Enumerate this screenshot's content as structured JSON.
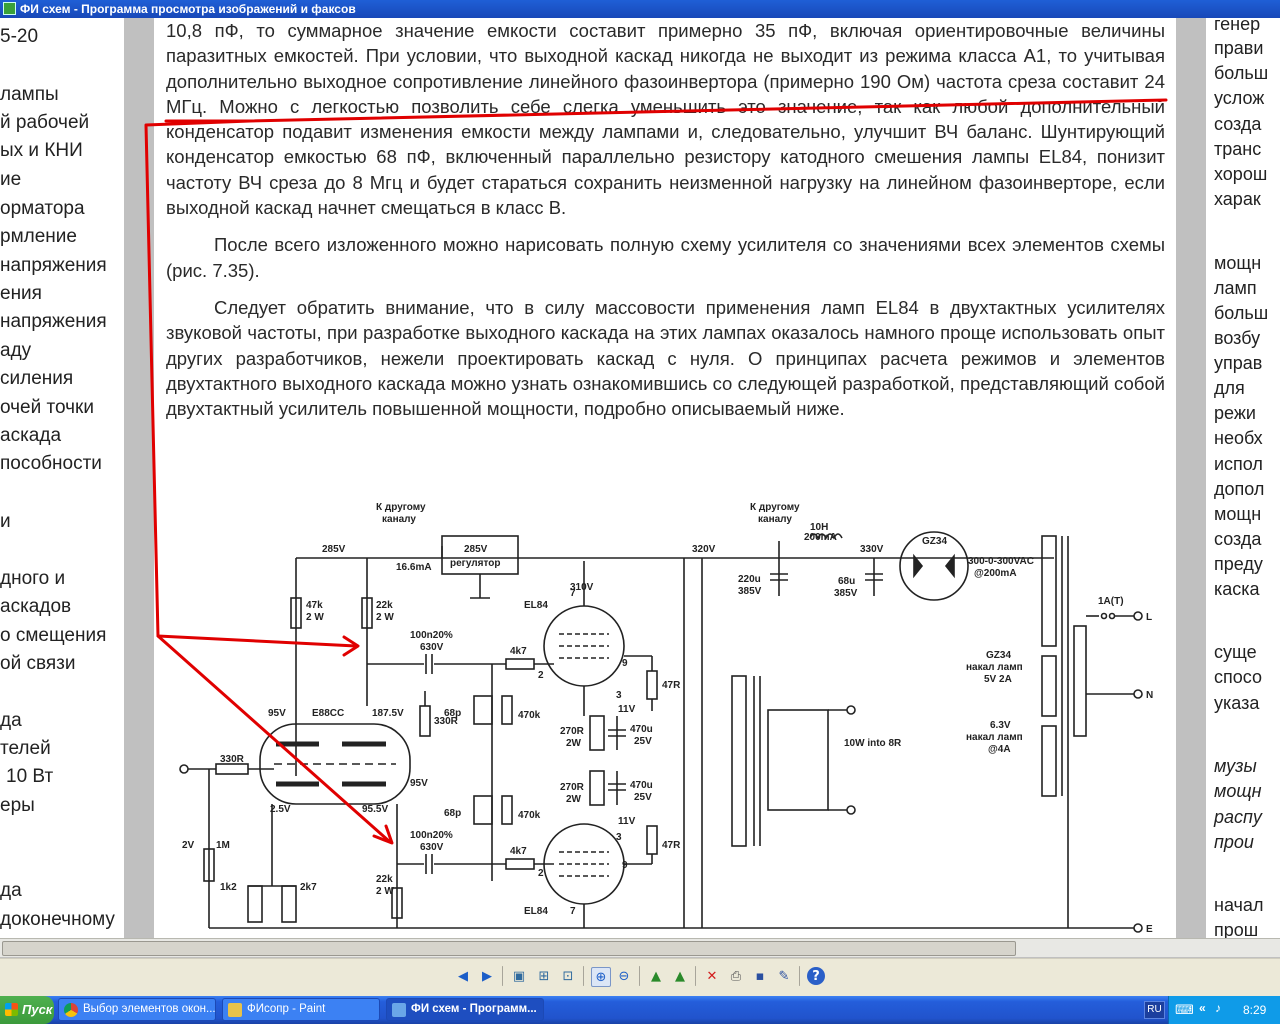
{
  "window": {
    "title": "ФИ схем - Программа просмотра изображений и факсов"
  },
  "left_page": {
    "lines": [
      "5-20",
      "лампы",
      "й рабочей",
      "ых и КНИ",
      "ие",
      "орматора",
      "рмление",
      "напряжения",
      "ения",
      "напряжения",
      "аду",
      "силения",
      "очей точки",
      "аскада",
      "пособности",
      "и",
      "дного и",
      "аскадов",
      "о смещения",
      "ой связи",
      "да",
      "телей",
      "10 Вт",
      "еры",
      "да",
      "доконечному"
    ]
  },
  "document": {
    "paragraph1": "10,8 пФ, то суммарное значение емкости составит примерно 35 пФ, включая ориентировочные величины паразитных емкостей. При условии, что выходной каскад никогда не выходит из режима класса А1, то учитывая дополнительно выходное сопротивление линейного фазоинвертора (примерно 190 Ом) частота среза составит 24 МГц. Можно с легкостью позволить себе слегка уменьшить это значение, так как любой дополнительный конденсатор подавит изменения емкости между лампами и, следовательно, улучшит ВЧ баланс. Шунтирующий конденсатор емкостью 68 пФ, включенный параллельно резистору катодного смешения лампы EL84, понизит частоту ВЧ среза до 8 Мгц и будет стараться сохранить неизменной нагрузку на линейном фазоинверторе, если выходной каскад начнет смещаться в класс В.",
    "paragraph2": "После всего изложенного можно нарисовать полную схему усилителя со значениями всех элементов схемы (рис. 7.35).",
    "paragraph3": "Следует обратить внимание, что в силу массовости применения ламп EL84 в двухтактных усилителях звуковой частоты, при разработке выходного каскада на этих лампах оказалось намного проще использовать опыт других разработчиков, нежели проектировать каскад с нуля. О принципах расчета режимов и элементов двухтактного выходного каскада можно узнать ознакомившись со следующей разработкой, представляющий собой двухтактный усилитель повышенной мощности, подробно описываемый ниже."
  },
  "schematic": {
    "labels": {
      "to_other_channel": "К другому",
      "channel": "каналу",
      "v285": "285V",
      "ma166": "16.6mA",
      "reg_v": "285V",
      "reg_name": "регулятор",
      "v320": "320V",
      "c220": "220u",
      "c220v": "385V",
      "choke": "10H",
      "choke_ma": "200mA",
      "v330": "330V",
      "c68": "68u",
      "c68v": "385V",
      "gz34_top": "GZ34",
      "trafo1": "300-0-300VAC",
      "trafo2": "@200mA",
      "fuse": "1A(T)",
      "term_l": "L",
      "term_n": "N",
      "term_e": "E",
      "gz34_heat": "GZ34",
      "heat_label": "накал ламп",
      "heat_v1": "5V 2A",
      "heat_v2": "6.3V",
      "heat_a2": "@4A",
      "r47k": "47k",
      "r47k_w": "2 W",
      "r22k": "22k",
      "r22k_w": "2 W",
      "cap100": "100n20%",
      "cap630": "630V",
      "r4k7": "4k7",
      "el84": "EL84",
      "v310": "310V",
      "pin9": "9",
      "pin3": "3",
      "pin2": "2",
      "pin7": "7",
      "r47r": "47R",
      "c68p": "68p",
      "r470k": "470k",
      "v11": "11V",
      "r270": "270R",
      "r270w": "2W",
      "c470": "470u",
      "c470v": "25V",
      "v95": "95V",
      "e88cc": "E88CC",
      "v1875": "187.5V",
      "r330r": "330R",
      "v95b": "95V",
      "r330in": "330R",
      "v25": "2.5V",
      "v955": "95.5V",
      "v2": "2V",
      "r1m": "1M",
      "r1k2": "1k2",
      "r2k7": "2k7",
      "out": "10W into 8R"
    }
  },
  "right_page": {
    "lines": [
      "генер",
      "прави",
      "больш",
      "услож",
      "созда",
      "транс",
      "хорош",
      "харак",
      "мощн",
      "ламп",
      "больш",
      "возбу",
      "управ",
      "для",
      "режи",
      "необх",
      "испол",
      "допол",
      "мощн",
      "созда",
      "преду",
      "каска",
      "суще",
      "спосо",
      "указа",
      "музы",
      "мощн",
      "распу",
      "прои",
      "начал",
      "прош"
    ]
  },
  "toolbar": {
    "buttons": [
      "prev",
      "next",
      "best-fit",
      "actual-size",
      "slideshow",
      "zoom-in",
      "zoom-out",
      "rotate-cw",
      "rotate-ccw",
      "delete",
      "print",
      "save",
      "edit",
      "help"
    ]
  },
  "taskbar": {
    "start_label": "Пуск",
    "tasks": [
      {
        "label": "Выбор элементов окон...",
        "active": false
      },
      {
        "label": "ФИсопр - Paint",
        "active": false
      },
      {
        "label": "ФИ схем - Программ...",
        "active": true
      }
    ],
    "lang": "RU",
    "time": "8:29"
  },
  "colors": {
    "annotation_red": "#e00000",
    "title_blue": "#1f5fd6",
    "taskbar_blue": "#245edb"
  }
}
